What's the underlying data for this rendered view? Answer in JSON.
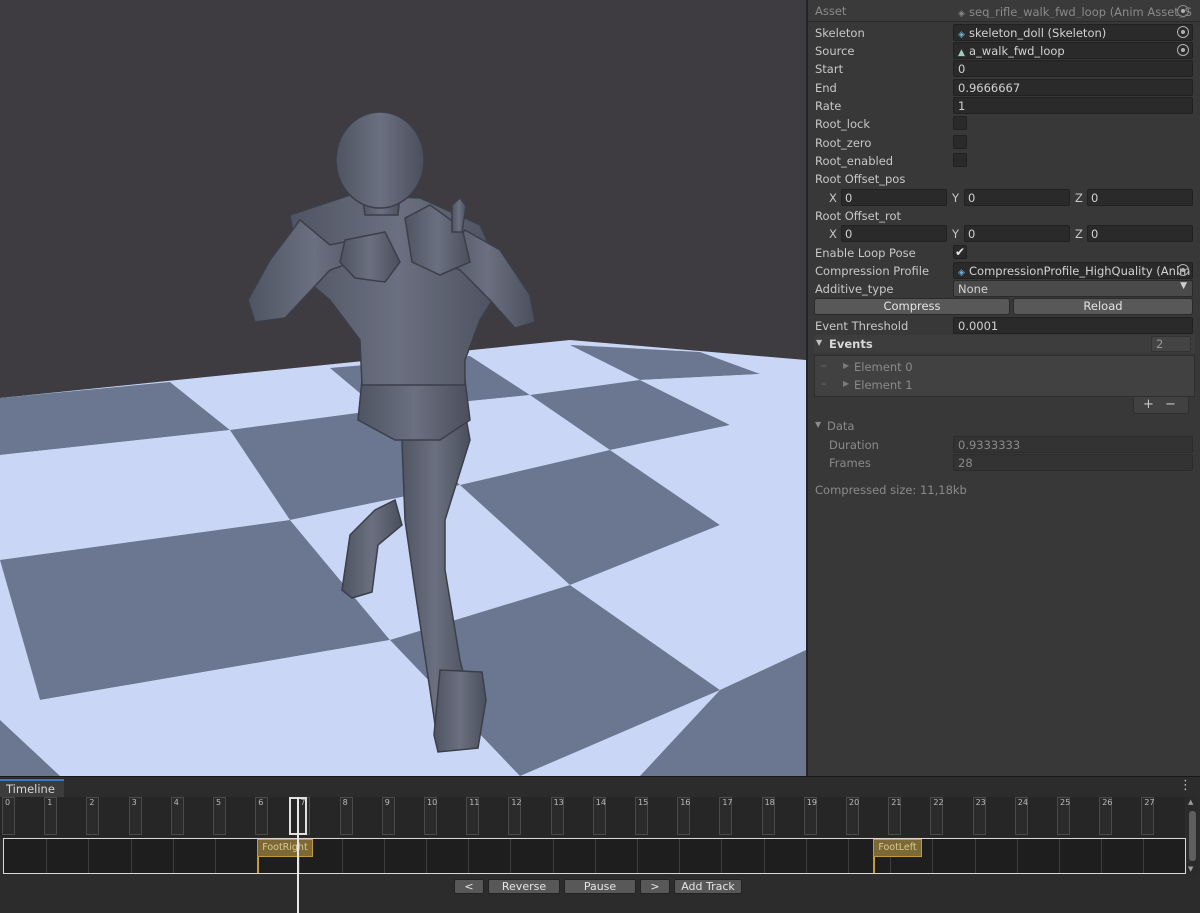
{
  "inspector": {
    "asset_label": "Asset",
    "asset_value": "seq_rifle_walk_fwd_loop (Anim Asset_Seq",
    "skeleton": {
      "label": "Skeleton",
      "value": "skeleton_doll (Skeleton)"
    },
    "source": {
      "label": "Source",
      "value": "a_walk_fwd_loop"
    },
    "start": {
      "label": "Start",
      "value": "0"
    },
    "end": {
      "label": "End",
      "value": "0.9666667"
    },
    "rate": {
      "label": "Rate",
      "value": "1"
    },
    "root_lock": {
      "label": "Root_lock",
      "checked": false
    },
    "root_zero": {
      "label": "Root_zero",
      "checked": false
    },
    "root_enabled": {
      "label": "Root_enabled",
      "checked": false
    },
    "root_offset_pos": {
      "label": "Root Offset_pos",
      "x_label": "X",
      "y_label": "Y",
      "z_label": "Z",
      "x": "0",
      "y": "0",
      "z": "0"
    },
    "root_offset_rot": {
      "label": "Root Offset_rot",
      "x_label": "X",
      "y_label": "Y",
      "z_label": "Z",
      "x": "0",
      "y": "0",
      "z": "0"
    },
    "enable_loop_pose": {
      "label": "Enable Loop Pose",
      "checked": true,
      "check_glyph": "✔"
    },
    "compression_profile": {
      "label": "Compression Profile",
      "value": "CompressionProfile_HighQuality (Anim"
    },
    "additive_type": {
      "label": "Additive_type",
      "value": "None"
    },
    "compress_button": "Compress",
    "reload_button": "Reload",
    "event_threshold": {
      "label": "Event Threshold",
      "value": "0.0001"
    },
    "events": {
      "label": "Events",
      "count": "2",
      "elements": [
        "Element 0",
        "Element 1"
      ],
      "add": "+",
      "remove": "−"
    },
    "data": {
      "label": "Data",
      "duration": {
        "label": "Duration",
        "value": "0.9333333"
      },
      "frames": {
        "label": "Frames",
        "value": "28"
      }
    },
    "compressed_size": "Compressed size: 11,18kb"
  },
  "timeline": {
    "tab_label": "Timeline",
    "menu_glyph": "⋮",
    "frame_labels": [
      "0",
      "1",
      "2",
      "3",
      "4",
      "5",
      "6",
      "7",
      "8",
      "9",
      "10",
      "11",
      "12",
      "13",
      "14",
      "15",
      "16",
      "17",
      "18",
      "19",
      "20",
      "21",
      "22",
      "23",
      "24",
      "25",
      "26",
      "27"
    ],
    "current_frame": 7,
    "events": [
      {
        "name": "FootRight",
        "frame": 6
      },
      {
        "name": "FootLeft",
        "frame": 20.6
      }
    ],
    "buttons": {
      "prev": "<",
      "reverse": "Reverse",
      "pause": "Pause",
      "next": ">",
      "add_track": "Add Track"
    }
  },
  "colors": {
    "accent_tab": "#3a79bb",
    "event_fill": "#7b6a36",
    "event_border": "#c59a3a",
    "floor_light": "#c9d6f6",
    "floor_dark": "#6b7690",
    "background": "#3e3c41",
    "character": "#5c6170"
  },
  "icons": {
    "skeleton": "skeleton-asset-icon",
    "source": "animation-clip-icon",
    "compression": "compression-profile-icon",
    "picker": "object-picker-icon",
    "dropdown": "dropdown-arrow-icon",
    "foldout": "foldout-triangle-icon",
    "menu": "kebab-menu-icon"
  }
}
